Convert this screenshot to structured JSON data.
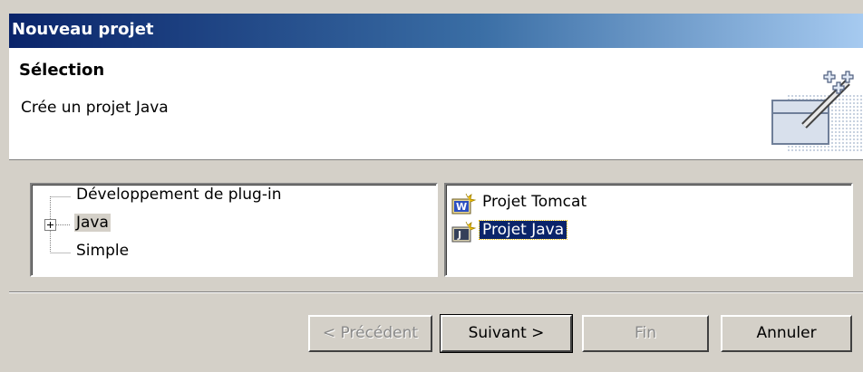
{
  "window": {
    "title": "Nouveau projet"
  },
  "header": {
    "title": "Sélection",
    "description": "Crée un projet Java"
  },
  "wizard_tree": {
    "items": [
      {
        "label": "Développement de plug-in",
        "expander": "none"
      },
      {
        "label": "Java",
        "expander": "plus",
        "selected": true
      },
      {
        "label": "Simple",
        "expander": "none"
      }
    ]
  },
  "wizard_list": {
    "items": [
      {
        "label": "Projet Tomcat",
        "icon": "tomcat-project-icon",
        "selected": false
      },
      {
        "label": "Projet Java",
        "icon": "java-project-icon",
        "selected": true
      }
    ]
  },
  "buttons": {
    "back": "< Précédent",
    "next": "Suivant >",
    "finish": "Fin",
    "cancel": "Annuler"
  },
  "colors": {
    "title_bar_start": "#0a246a",
    "title_bar_end": "#a6caf0",
    "selection": "#0a246a",
    "dialog_bg": "#d4d0c8"
  }
}
